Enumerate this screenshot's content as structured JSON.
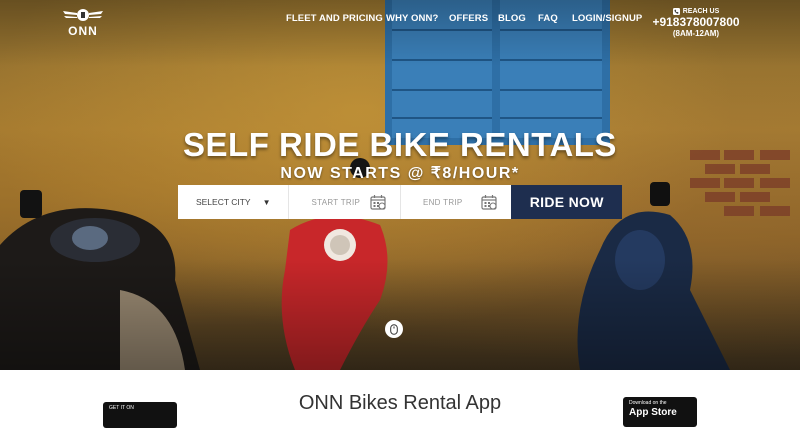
{
  "brand": {
    "name": "ONN",
    "logo_icon": "winged-helmet-icon"
  },
  "nav": {
    "items": [
      {
        "label": "FLEET AND PRICING"
      },
      {
        "label": "WHY ONN?"
      },
      {
        "label": "OFFERS"
      },
      {
        "label": "BLOG"
      },
      {
        "label": "FAQ"
      },
      {
        "label": "LOGIN/SIGNUP"
      }
    ]
  },
  "contact": {
    "reach_label": "REACH US",
    "phone": "+918378007800",
    "hours": "(8AM-12AM)",
    "icon": "phone-icon"
  },
  "hero": {
    "headline": "SELF RIDE BIKE RENTALS",
    "subheadline": "NOW STARTS @ ₹8/HOUR*"
  },
  "search": {
    "city_label": "SELECT CITY",
    "start_label": "START TRIP",
    "end_label": "END TRIP",
    "button_label": "RIDE NOW"
  },
  "app_section": {
    "title": "ONN Bikes Rental App",
    "google_play_small": "GET IT ON",
    "app_store_small": "Download on the",
    "app_store_big": "App Store"
  },
  "colors": {
    "accent": "#1e2e4f",
    "text_white": "#ffffff",
    "background": "#ffffff"
  }
}
